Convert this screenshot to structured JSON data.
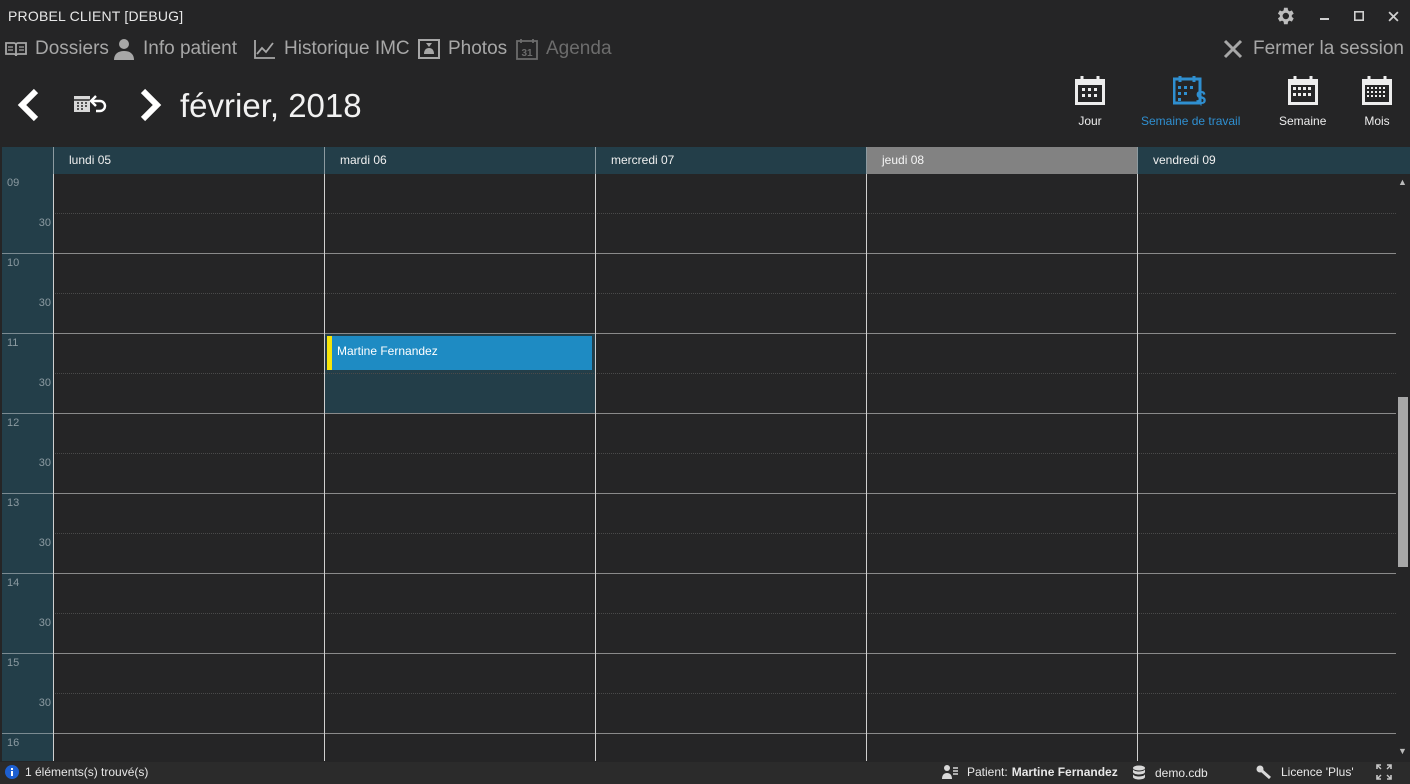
{
  "app": {
    "title": "PROBEL CLIENT [DEBUG]"
  },
  "menu": {
    "items": [
      {
        "label": "Dossiers",
        "icon": "book-icon",
        "enabled": true
      },
      {
        "label": "Info patient",
        "icon": "person-icon",
        "enabled": true
      },
      {
        "label": "Historique IMC",
        "icon": "line-chart-icon",
        "enabled": true
      },
      {
        "label": "Photos",
        "icon": "photo-icon",
        "enabled": true
      },
      {
        "label": "Agenda",
        "icon": "calendar-31-icon",
        "enabled": false
      }
    ],
    "logout": "Fermer la session"
  },
  "nav": {
    "period": "février, 2018",
    "views": [
      {
        "label": "Jour",
        "active": false
      },
      {
        "label": "Semaine de travail",
        "active": true
      },
      {
        "label": "Semaine",
        "active": false
      },
      {
        "label": "Mois",
        "active": false
      }
    ]
  },
  "calendar": {
    "days": [
      "lundi 05",
      "mardi 06",
      "mercredi 07",
      "jeudi 08",
      "vendredi 09"
    ],
    "today_index": 3,
    "hours": [
      "09",
      "10",
      "11",
      "12",
      "13",
      "14",
      "15",
      "16"
    ],
    "half_label": "30",
    "appointment": {
      "title": "Martine Fernandez",
      "day_index": 1,
      "start": "11:00",
      "end": "11:30"
    },
    "selected_slot": {
      "day_index": 1,
      "start": "11:00",
      "end": "12:00"
    }
  },
  "status": {
    "found": "1 éléments(s) trouvé(s)",
    "patient_label": "Patient:",
    "patient_name": "Martine Fernandez",
    "database": "demo.cdb",
    "license": "Licence 'Plus'"
  },
  "colors": {
    "background": "#252526",
    "header": "#233e49",
    "today": "#828282",
    "accent": "#2f8fd0",
    "appointment": "#1e8bc3",
    "appointment_marker": "#f5e50a"
  }
}
